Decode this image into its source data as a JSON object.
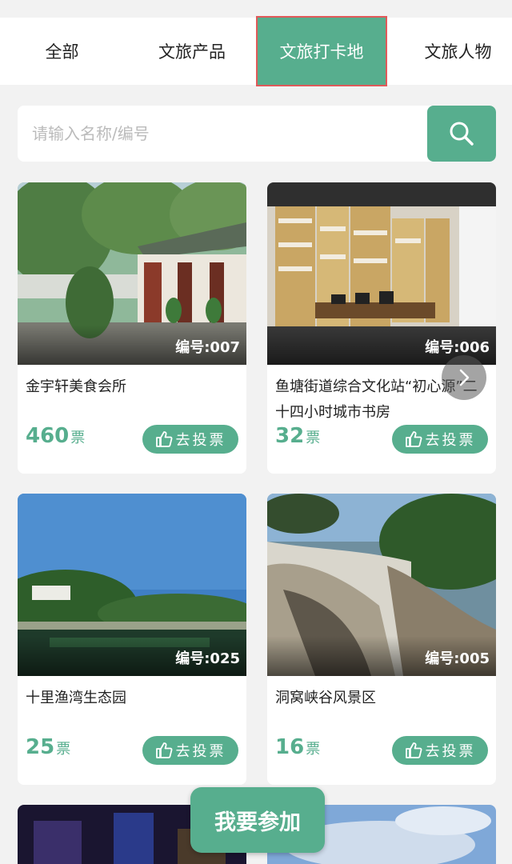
{
  "tabs": [
    "全部",
    "文旅产品",
    "文旅打卡地",
    "文旅人物"
  ],
  "active_tab": "文旅打卡地",
  "search": {
    "placeholder": "请输入名称/编号",
    "icon": "search-icon"
  },
  "cards": [
    {
      "id_label": "编号:007",
      "title": "金宇轩美食会所",
      "votes": "460",
      "unit": "票",
      "vote_label": "去投票"
    },
    {
      "id_label": "编号:006",
      "title": "鱼塘街道综合文化站“初心源”二十四小时城市书房",
      "votes": "32",
      "unit": "票",
      "vote_label": "去投票"
    },
    {
      "id_label": "编号:025",
      "title": "十里渔湾生态园",
      "votes": "25",
      "unit": "票",
      "vote_label": "去投票"
    },
    {
      "id_label": "编号:005",
      "title": "洞窝峡谷风景区",
      "votes": "16",
      "unit": "票",
      "vote_label": "去投票"
    }
  ],
  "join_label": "我要参加",
  "colors": {
    "accent": "#57ae8e",
    "active_tab_border": "#e05a5a",
    "background": "#f2f2f2"
  }
}
